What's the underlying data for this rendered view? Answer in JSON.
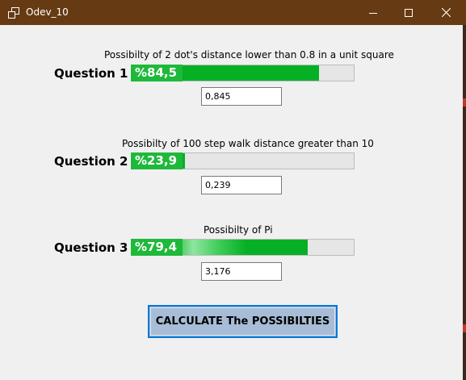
{
  "window": {
    "title": "Odev_10",
    "controls": {
      "minimize_icon": "minimize-icon",
      "maximize_icon": "maximize-icon",
      "close_icon": "close-icon"
    },
    "titlebar_color": "#663a13"
  },
  "questions": [
    {
      "label": "Question 1",
      "description": "Possibilty of 2 dot's distance lower than 0.8 in a unit square",
      "percent_text": "%84,5",
      "progress": 0.845,
      "result": "0,845"
    },
    {
      "label": "Question 2",
      "description": "Possibilty of 100 step walk distance greater than 10",
      "percent_text": "%23,9",
      "progress": 0.239,
      "result": "0,239"
    },
    {
      "label": "Question 3",
      "description": "Possibilty of Pi",
      "percent_text": "%79,4",
      "progress": 0.794,
      "result": "3,176"
    }
  ],
  "calculate_button": {
    "label": "CALCULATE The POSSIBILTIES"
  },
  "colors": {
    "progress_fill": "#06b025",
    "progress_track": "#e6e6e6",
    "button_bg": "#a7bcd6",
    "button_border": "#0078d7"
  }
}
